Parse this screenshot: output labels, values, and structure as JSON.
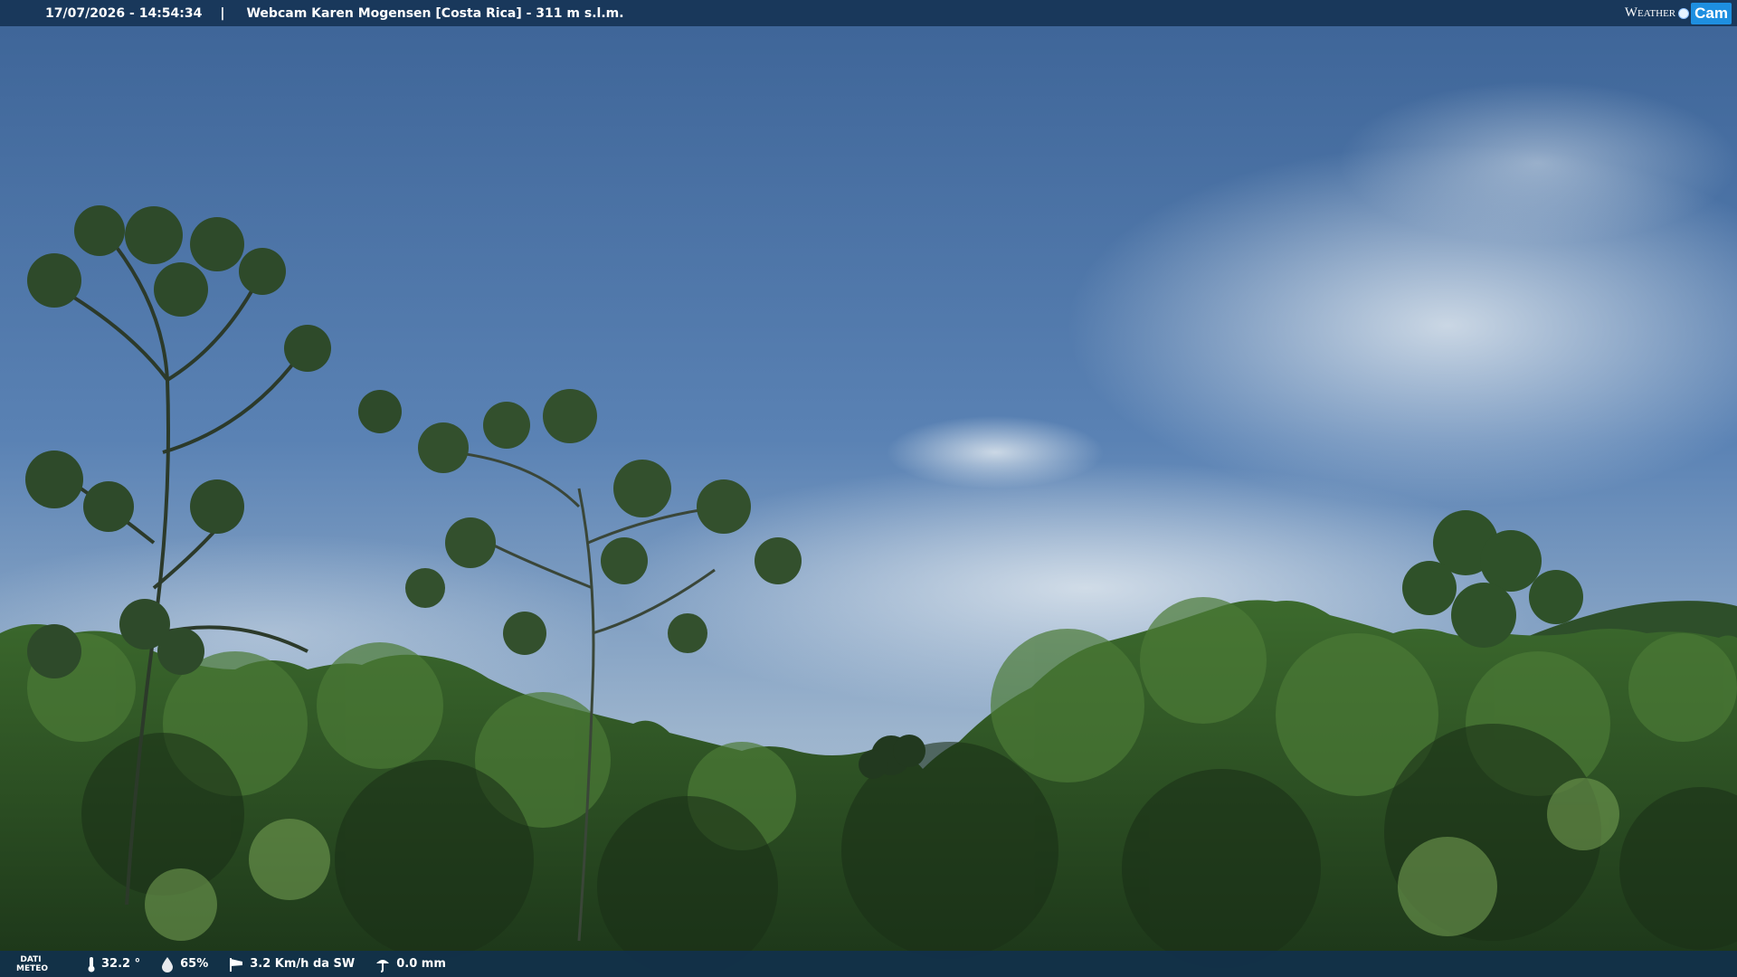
{
  "header": {
    "datetime": "17/07/2026 - 14:54:34",
    "separator": "|",
    "title": "Webcam Karen Mogensen [Costa Rica]  - 311 m s.l.m."
  },
  "logo": {
    "part1": "Weather",
    "part2": "Cam",
    "icon": "sun-globe-icon"
  },
  "weather": {
    "label_line1": "DATI",
    "label_line2": "METEO",
    "temperature": "32.2 °",
    "humidity": "65%",
    "wind": "3.2 Km/h da SW",
    "rain": "0.0 mm",
    "icons": [
      "thermometer-icon",
      "humidity-drop-icon",
      "wind-sock-icon",
      "rain-gauge-icon"
    ]
  },
  "colors": {
    "sky_top": "#40679a",
    "sky_mid": "#5f86b8",
    "sky_low": "#9db6cf",
    "foliage_dark": "#1f3a1e",
    "foliage_mid": "#3e6e2e",
    "foliage_light": "#6f9a4a",
    "bar": "#163456"
  }
}
